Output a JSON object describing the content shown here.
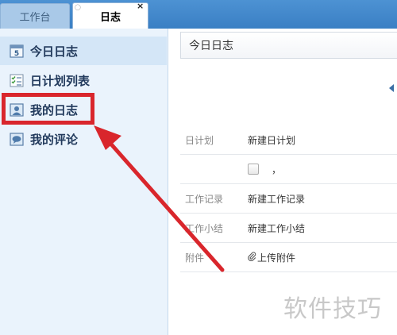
{
  "tabs": [
    {
      "label": "工作台",
      "active": false
    },
    {
      "label": "日志",
      "active": true
    }
  ],
  "tab_close": "×",
  "sidebar": {
    "items": [
      {
        "label": "今日日志",
        "icon": "calendar-icon",
        "active": true
      },
      {
        "label": "日计划列表",
        "icon": "checklist-icon",
        "active": false
      },
      {
        "label": "我的日志",
        "icon": "user-card-icon",
        "active": false,
        "highlighted": true
      },
      {
        "label": "我的评论",
        "icon": "comment-icon",
        "active": false
      }
    ]
  },
  "main": {
    "title": "今日日志",
    "rows": [
      {
        "label": "日计划",
        "value": "新建日计划"
      },
      {
        "label": "",
        "value": "，",
        "checkbox": true
      },
      {
        "label": "工作记录",
        "value": "新建工作记录"
      },
      {
        "label": "工作小结",
        "value": "新建工作小结"
      },
      {
        "label": "附件",
        "value": "上传附件",
        "icon": "paperclip-icon"
      }
    ]
  },
  "watermark": "软件技巧",
  "colors": {
    "topbar": "#3f86ca",
    "sidebar_bg": "#eaf3fc",
    "highlight": "#d9262c",
    "annotation_arrow": "#d9262c"
  }
}
